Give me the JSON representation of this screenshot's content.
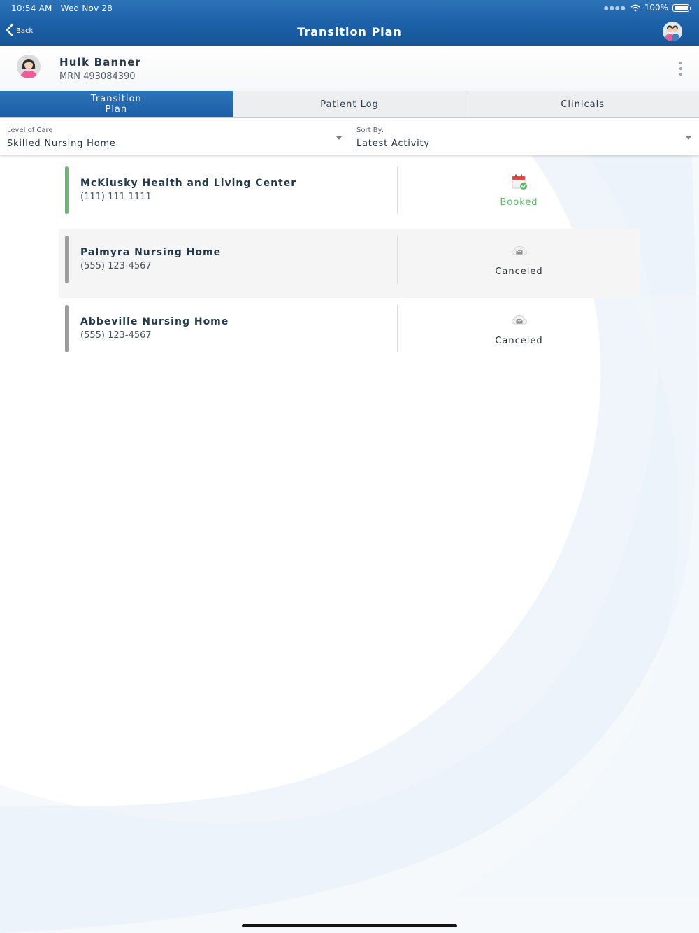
{
  "status_bar": {
    "time": "10:54 AM",
    "date": "Wed Nov 28",
    "battery": "100%"
  },
  "nav": {
    "back_label": "Back",
    "title": "Transition Plan"
  },
  "patient": {
    "name": "Hulk Banner",
    "mrn": "MRN 493084390"
  },
  "tabs": [
    {
      "label": "Transition Plan",
      "active": true
    },
    {
      "label": "Patient Log",
      "active": false
    },
    {
      "label": "Clinicals",
      "active": false
    }
  ],
  "filters": {
    "level_of_care": {
      "label": "Level of Care",
      "value": "Skilled Nursing Home"
    },
    "sort_by": {
      "label": "Sort By:",
      "value": "Latest Activity"
    }
  },
  "facilities": [
    {
      "name": "McKlusky Health and Living Center",
      "phone": "(111) 111-1111",
      "status": "Booked",
      "status_icon": "calendar-check-icon",
      "accent": "#67bd6b"
    },
    {
      "name": "Palmyra Nursing Home",
      "phone": "(555) 123-4567",
      "status": "Canceled",
      "status_icon": "cloud-envelope-icon",
      "accent": "#9e9e9e"
    },
    {
      "name": "Abbeville Nursing Home",
      "phone": "(555) 123-4567",
      "status": "Canceled",
      "status_icon": "cloud-envelope-icon",
      "accent": "#9e9e9e"
    }
  ],
  "colors": {
    "brand_blue": "#1b5fa6",
    "booked_green": "#5bb762",
    "tab_inactive": "#eceef0"
  }
}
